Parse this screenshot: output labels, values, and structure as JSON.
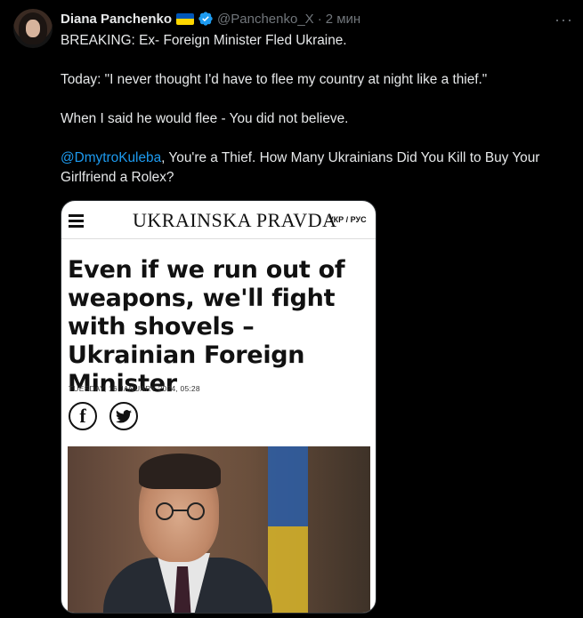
{
  "tweet": {
    "author_name": "Diana Panchenko",
    "handle": "@Panchenko_X",
    "separator": "·",
    "time": "2 мин",
    "more_label": "···",
    "lines": [
      "BREAKING: Ex- Foreign Minister Fled Ukraine.",
      "Today: \"I never thought I'd have to flee my country at night like a thief.\"",
      "When I said he would flee - You did not believe."
    ],
    "mention": "@DmytroKuleba",
    "mention_rest": ", You're a Thief. How Many Ukrainians Did You Kill to Buy Your Girlfriend a Rolex?"
  },
  "article": {
    "logo": "UKRAINSKA PRAVDA",
    "lang": "УКР / РУС",
    "headline": "Even if we run out of weapons, we'll fight with shovels – Ukrainian Foreign Minister",
    "date": "TUESDAY, 16 JANUARY 2024, 05:28",
    "facebook_glyph": "f"
  },
  "colors": {
    "background": "#000000",
    "text": "#e7e9ea",
    "muted": "#71767b",
    "link": "#1d9bf0",
    "verified": "#1d9bf0"
  },
  "icons": [
    "ukraine-flag-icon",
    "verified-badge-icon",
    "more-icon",
    "hamburger-menu-icon",
    "facebook-icon",
    "twitter-icon"
  ]
}
